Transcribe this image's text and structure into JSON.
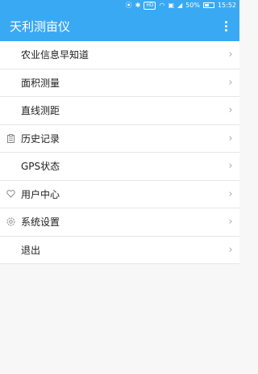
{
  "status_bar": {
    "hd_label": "HD",
    "battery_text": "50%",
    "time": "15:52",
    "icons": [
      "location-icon",
      "bluetooth-icon",
      "wifi-icon",
      "sim-icon",
      "signal-icon",
      "battery-icon"
    ]
  },
  "app_bar": {
    "title": "天利测亩仪",
    "overflow_icon": "more-vertical-icon"
  },
  "menu": {
    "items": [
      {
        "label": "农业信息早知道",
        "icon": ""
      },
      {
        "label": "面积测量",
        "icon": ""
      },
      {
        "label": "直线测距",
        "icon": ""
      },
      {
        "label": "历史记录",
        "icon": "clipboard-icon"
      },
      {
        "label": "GPS状态",
        "icon": ""
      },
      {
        "label": "用户中心",
        "icon": "heart-icon"
      },
      {
        "label": "系统设置",
        "icon": "settings-icon"
      },
      {
        "label": "退出",
        "icon": ""
      }
    ],
    "chevron": "›"
  },
  "colors": {
    "primary": "#3aa9f3",
    "divider": "#e6e6e6",
    "text": "#222222",
    "background": "#f7f7f7"
  }
}
